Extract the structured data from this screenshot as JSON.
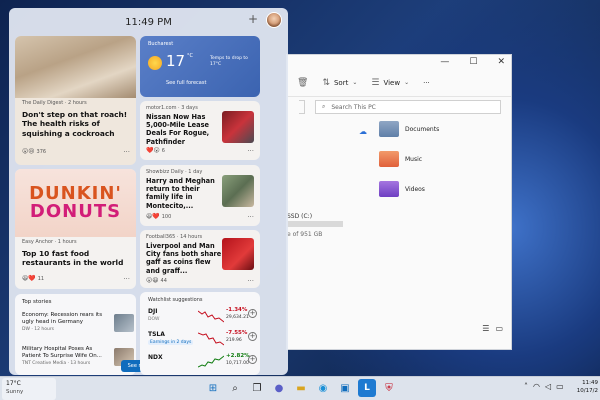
{
  "widgets": {
    "time": "11:49 PM",
    "add_label": "+",
    "cards": {
      "roach": {
        "source": "The Daily Digest · 2 hours",
        "headline": "Don't step on that roach! The health risks of squishing a cockroach",
        "reactions": "376"
      },
      "weather": {
        "location": "Bucharest",
        "temp": "17",
        "unit": "°C",
        "note": "Temps to drop to 17°C",
        "link": "See full forecast"
      },
      "nissan": {
        "source": "motor1.com · 3 days",
        "headline": "Nissan Now Has 5,000-Mile Lease Deals For Rogue, Pathfinder",
        "reactions": "6"
      },
      "dunkin": {
        "brand_line1": "DUNKIN'",
        "brand_line2": "DONUTS",
        "source": "Easy Anchor · 1 hours",
        "headline": "Top 10 fast food restaurants in the world",
        "reactions": "11"
      },
      "harry": {
        "source": "Showbizz Daily · 1 day",
        "headline": "Harry and Meghan return to their family life in Montecito,...",
        "reactions": "100"
      },
      "liverpool": {
        "source": "Football365 · 14 hours",
        "headline": "Liverpool and Man City fans both share gaff as coins flew and graff...",
        "reactions": "44"
      },
      "top_stories": {
        "title": "Top stories",
        "items": [
          {
            "headline": "Economy: Recession rears its ugly head in Germany",
            "source": "DW · 12 hours"
          },
          {
            "headline": "Military Hospital Poses As Patient To Surprise Wife On...",
            "source": "TNT Creative Media · 13 hours"
          }
        ],
        "see_more": "See more"
      },
      "watchlist": {
        "title": "Watchlist suggestions",
        "stocks": [
          {
            "ticker": "DJI",
            "sub": "DOW",
            "change": "-1.34%",
            "price": "29,634.21",
            "trend": "down"
          },
          {
            "ticker": "TSLA",
            "sub": "Earnings in 2 days",
            "change": "-7.55%",
            "price": "219.96",
            "trend": "down"
          },
          {
            "ticker": "NDX",
            "sub": "",
            "change": "+2.82%",
            "price": "10,717.00",
            "trend": "up"
          }
        ]
      }
    }
  },
  "explorer": {
    "commands": {
      "sort": "Sort",
      "view": "View",
      "more": "···"
    },
    "search_placeholder": "Search This PC",
    "folders": [
      "Documents",
      "Music",
      "Videos"
    ],
    "drive_label": "SSD (C:)",
    "drive_free": "e of 951 GB"
  },
  "taskbar": {
    "weather_temp": "17°C",
    "weather_cond": "Sunny",
    "clock_time": "11:49",
    "clock_date": "10/17/2"
  },
  "colors": {
    "accent": "#0f6cbd",
    "negative": "#c50f1f",
    "positive": "#107c10"
  }
}
